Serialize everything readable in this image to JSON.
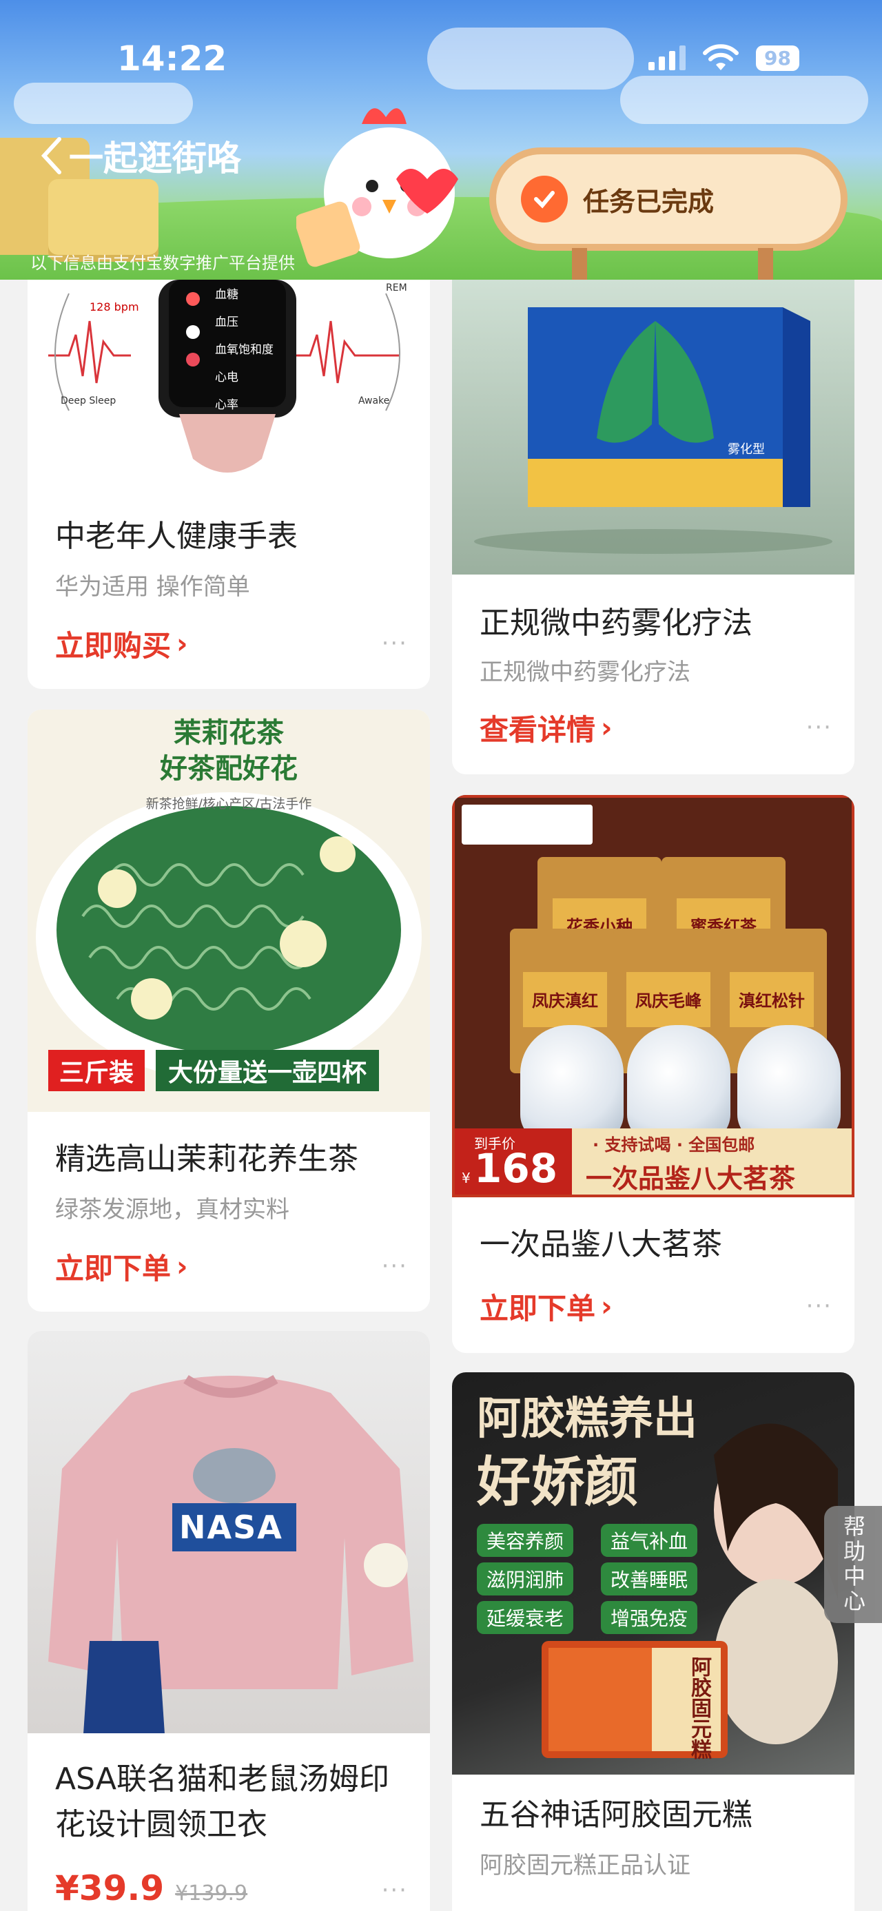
{
  "status_bar": {
    "time": "14:22",
    "battery": "98"
  },
  "header": {
    "back_label": "一起逛街咯",
    "task_label": "任务已完成",
    "disclaimer": "以下信息由支付宝数字推广平台提供"
  },
  "products": [
    {
      "title": "中老年人健康手表",
      "subtitle": "华为适用 操作简单",
      "cta": "立即购买",
      "more": "···",
      "image_text": {
        "bpm": "128 bpm",
        "deep": "Deep Sleep",
        "awake": "Awake",
        "rem": "REM",
        "menu": [
          "血糖",
          "血压",
          "血氧饱和度",
          "心电",
          "心率"
        ]
      }
    },
    {
      "title": "正规微中药雾化疗法",
      "subtitle": "正规微中药雾化疗法",
      "cta": "查看详情",
      "more": "···",
      "image_text": {
        "box_label": "雾化型"
      }
    },
    {
      "title": "精选高山茉莉花养生茶",
      "subtitle": "绿茶发源地，真材实料",
      "cta": "立即下单",
      "more": "···",
      "image_text": {
        "line1": "茉莉花茶",
        "line2": "好茶配好花",
        "tagline": "新茶抢鲜/核心产区/古法手作",
        "badge_red": "三斤装",
        "badge_green": "大份量送一壶四杯"
      }
    },
    {
      "title": "一次品鉴八大茗茶",
      "cta": "立即下单",
      "more": "···",
      "image_text": {
        "bags": [
          "花香小种",
          "蜜香红茶",
          "凤庆滇红",
          "凤庆毛峰",
          "滇红松针"
        ],
        "price_label": "到手价",
        "currency": "¥",
        "price": "168",
        "promo": "· 支持试喝 · 全国包邮",
        "slogan": "一次品鉴八大茗茶"
      }
    },
    {
      "title": "ASA联名猫和老鼠汤姆印花设计圆领卫衣",
      "price_now": "¥39.9",
      "price_old": "¥139.9",
      "more": "···",
      "image_text": {
        "logo": "NASA"
      }
    },
    {
      "title": "五谷神话阿胶固元糕",
      "subtitle": "阿胶固元糕正品认证",
      "image_text": {
        "line1": "阿胶糕养出",
        "line2": "好娇颜",
        "chips": [
          "美容养颜",
          "益气补血",
          "滋阴润肺",
          "改善睡眠",
          "延缓衰老",
          "增强免疫"
        ],
        "box": "阿胶固元糕"
      }
    }
  ],
  "help_label": "帮助中心",
  "colors": {
    "accent": "#e53a2a",
    "background": "#f2f2f2",
    "task_check": "#ff6a32"
  }
}
